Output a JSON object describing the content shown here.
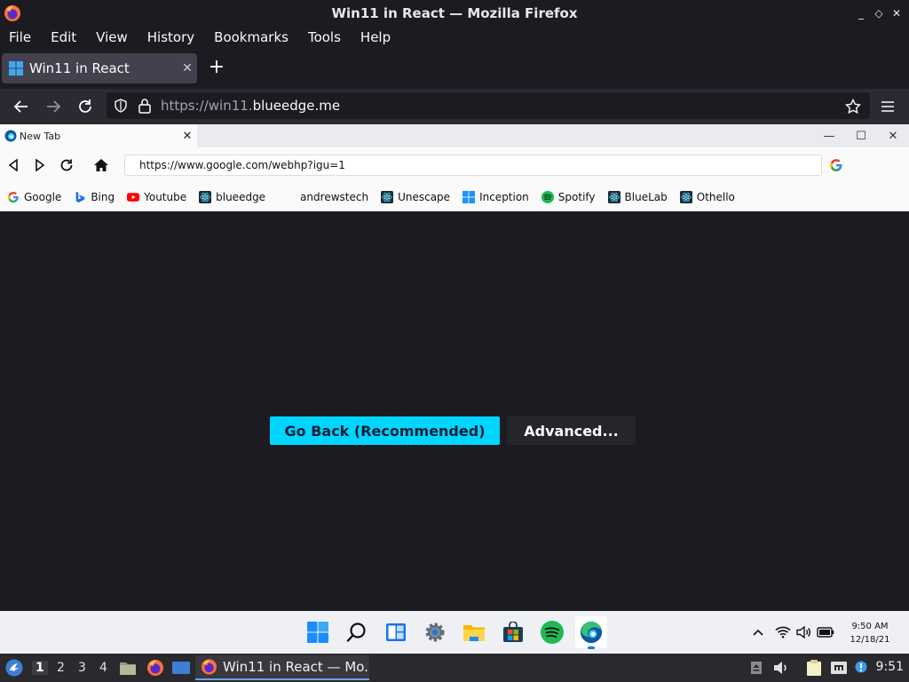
{
  "window": {
    "title": "Win11 in React — Mozilla Firefox",
    "controls": {
      "minimize": "_",
      "restore": "◇",
      "close": "✕"
    }
  },
  "menubar": {
    "items": [
      {
        "label": "File"
      },
      {
        "label": "Edit"
      },
      {
        "label": "View"
      },
      {
        "label": "History"
      },
      {
        "label": "Bookmarks"
      },
      {
        "label": "Tools"
      },
      {
        "label": "Help"
      }
    ]
  },
  "firefox": {
    "tab": {
      "title": "Win11 in React",
      "close": "✕"
    },
    "new_tab": "+",
    "url": {
      "prefix": "https://win11.",
      "domain": "blueedge.me"
    }
  },
  "edge": {
    "tab": {
      "title": "New Tab",
      "close": "✕"
    },
    "window_controls": {
      "minimize": "—",
      "maximize": "☐",
      "close": "✕"
    },
    "address": "https://www.google.com/webhp?igu=1",
    "bookmarks": [
      {
        "label": "Google",
        "icon": "google-icon"
      },
      {
        "label": "Bing",
        "icon": "bing-icon"
      },
      {
        "label": "Youtube",
        "icon": "youtube-icon"
      },
      {
        "label": "blueedge",
        "icon": "react-icon"
      },
      {
        "label": "andrewstech",
        "icon": "blank-icon"
      },
      {
        "label": "Unescape",
        "icon": "react-icon"
      },
      {
        "label": "Inception",
        "icon": "windows-icon"
      },
      {
        "label": "Spotify",
        "icon": "spotify-icon"
      },
      {
        "label": "BlueLab",
        "icon": "react-icon"
      },
      {
        "label": "Othello",
        "icon": "react-icon"
      }
    ]
  },
  "page": {
    "back_button": "Go Back (Recommended)",
    "advanced_button": "Advanced..."
  },
  "win11_taskbar": {
    "apps": [
      "start-icon",
      "search-icon",
      "widgets-icon",
      "settings-icon",
      "file-explorer-icon",
      "store-icon",
      "spotify-icon",
      "edge-icon"
    ],
    "active": "edge-icon",
    "clock_time": "9:50 AM",
    "clock_date": "12/18/21"
  },
  "panel": {
    "workspaces": [
      "1",
      "2",
      "3",
      "4"
    ],
    "current_workspace": "1",
    "task_label": "Win11 in React — Mo...",
    "time": "9:51"
  },
  "colors": {
    "firefox_dark": "#1c1b22",
    "firefox_toolbar": "#2b2a33",
    "accent_button": "#00d5ff",
    "secondary_button": "#26252c"
  }
}
